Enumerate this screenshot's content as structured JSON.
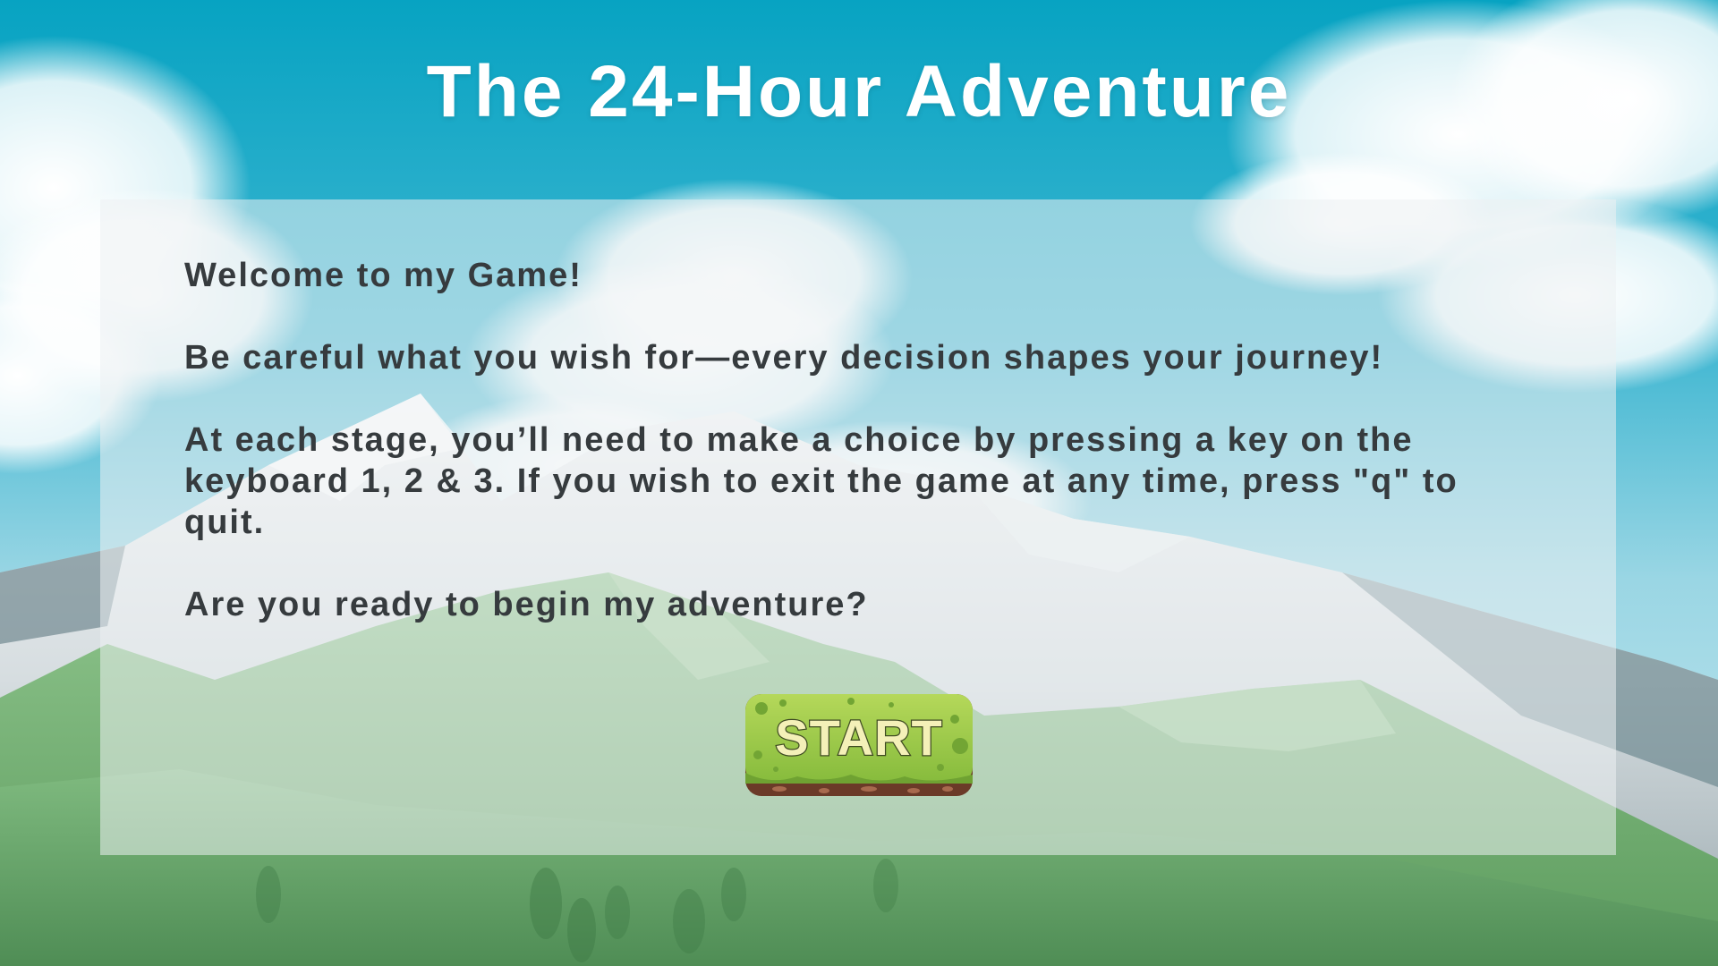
{
  "game": {
    "title": "The 24-Hour Adventure"
  },
  "intro_panel": {
    "paragraphs": [
      "Welcome to my Game!",
      "Be careful what you wish for—every decision shapes your journey!",
      "At each stage, you’ll need to make a choice by pressing a key on the keyboard 1, 2 & 3. If you wish to exit the game at any time, press \"q\" to quit.",
      "Are you ready to begin my adventure?"
    ]
  },
  "start_button": {
    "label": "START"
  },
  "colors": {
    "sky_top": "#0aa6c4",
    "sky_bottom": "#8fd0e0",
    "grass": "#6aa86a",
    "panel": "#eceff2",
    "text": "#363b3e",
    "title": "#ffffff",
    "button_green": "#9cc94a",
    "button_dirt": "#7a4632"
  }
}
